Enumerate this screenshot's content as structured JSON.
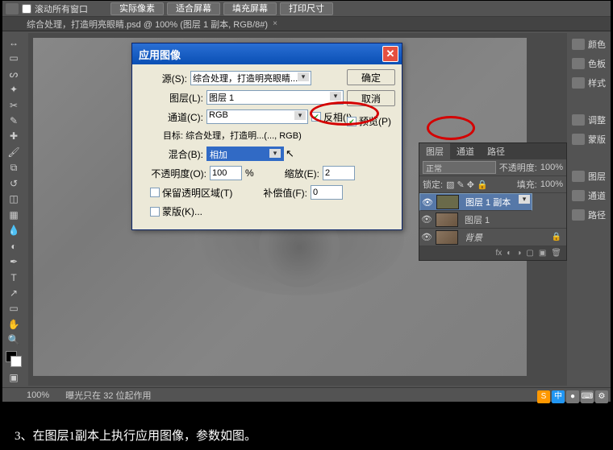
{
  "topbar": {
    "scroll_all_windows": "滚动所有窗口",
    "btn_actual": "实际像素",
    "btn_fit": "适合屏幕",
    "btn_fill": "填充屏幕",
    "btn_print": "打印尺寸"
  },
  "doc_tab": "综合处理，打造明亮眼睛.psd @ 100% (图层 1 副本, RGB/8#)",
  "dialog": {
    "title": "应用图像",
    "source_lbl": "源(S):",
    "source_val": "综合处理，打造明亮眼睛...",
    "layer_lbl": "图层(L):",
    "layer_val": "图层 1",
    "channel_lbl": "通道(C):",
    "channel_val": "RGB",
    "invert": "反相(I)",
    "target_lbl": "目标:",
    "target_val": "综合处理，打造明...(..., RGB)",
    "blend_lbl": "混合(B):",
    "blend_val": "相加",
    "opacity_lbl": "不透明度(O):",
    "opacity_val": "100",
    "pct": "%",
    "scale_lbl": "缩放(E):",
    "scale_val": "2",
    "preserve": "保留透明区域(T)",
    "offset_lbl": "补偿值(F):",
    "offset_val": "0",
    "mask": "蒙版(K)...",
    "ok": "确定",
    "cancel": "取消",
    "preview": "预览(P)"
  },
  "layers": {
    "tab_layers": "图层",
    "tab_channels": "通道",
    "tab_paths": "路径",
    "mode": "正常",
    "opacity_lbl": "不透明度:",
    "opacity_val": "100%",
    "lock_lbl": "锁定:",
    "fill_lbl": "填充:",
    "fill_val": "100%",
    "items": [
      {
        "name": "图层 1 副本",
        "locked": false
      },
      {
        "name": "图层 1",
        "locked": false
      },
      {
        "name": "背景",
        "locked": true
      }
    ]
  },
  "right_dock": {
    "color": "颜色",
    "swatches": "色板",
    "styles": "样式",
    "adjust": "调整",
    "masks": "蒙版",
    "layers": "图层",
    "channels": "通道",
    "paths": "路径"
  },
  "status": {
    "zoom": "100%",
    "info": "曝光只在 32 位起作用"
  },
  "caption": "3、在图层1副本上执行应用图像，参数如图。"
}
